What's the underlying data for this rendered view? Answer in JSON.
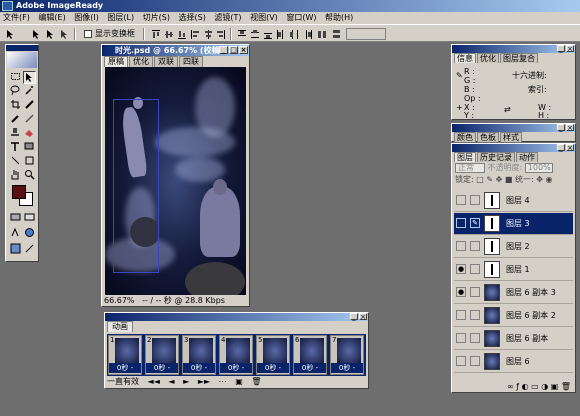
{
  "app": {
    "title": "Adobe ImageReady"
  },
  "menu": [
    "文件(F)",
    "编辑(E)",
    "图像(I)",
    "图层(L)",
    "切片(S)",
    "选择(S)",
    "滤镜(T)",
    "视图(V)",
    "窗口(W)",
    "帮助(H)"
  ],
  "options": {
    "show_bounds_label": "显示变换框"
  },
  "document": {
    "title": "时光.psd @ 66.67% (校稿)",
    "tabs": [
      "原稿",
      "优化",
      "双联",
      "四联"
    ],
    "active_tab": "原稿",
    "zoom": "66.67%",
    "status_time": "-- / -- 秒 @ 28.8 Kbps"
  },
  "animation": {
    "tab": "动画",
    "frames": [
      {
        "num": "1",
        "delay": "0秒 -"
      },
      {
        "num": "2",
        "delay": "0秒 -"
      },
      {
        "num": "3",
        "delay": "0秒 -"
      },
      {
        "num": "4",
        "delay": "0秒 -"
      },
      {
        "num": "5",
        "delay": "0秒 -"
      },
      {
        "num": "6",
        "delay": "0秒 -"
      },
      {
        "num": "7",
        "delay": "0秒 -"
      }
    ],
    "loop": "一直有效"
  },
  "info_panel": {
    "tabs": [
      "信息",
      "优化",
      "图层复合"
    ],
    "active_tab": "信息",
    "rows": {
      "r": "R :",
      "g": "G :",
      "b": "B :",
      "op": "Op :",
      "x": "X :",
      "y": "Y :",
      "w": "W :",
      "h": "H :"
    },
    "hex_label": "十六进制:",
    "index_label": "索引:"
  },
  "color_panel": {
    "tabs": [
      "颜色",
      "色板",
      "样式"
    ]
  },
  "layers_panel": {
    "tabs": [
      "图层",
      "历史记录",
      "动作"
    ],
    "active_tab": "图层",
    "blend_mode": "正常",
    "opacity_label": "不透明度:",
    "opacity_value": "100%",
    "lock_label": "锁定:",
    "unify_label": "统一:",
    "layers": [
      {
        "name": "图层 4",
        "eye": false,
        "thumb": "txt",
        "active": false
      },
      {
        "name": "图层 3",
        "eye": false,
        "thumb": "txt",
        "active": true
      },
      {
        "name": "图层 2",
        "eye": false,
        "thumb": "txt",
        "active": false
      },
      {
        "name": "图层 1",
        "eye": true,
        "thumb": "txt",
        "active": false
      },
      {
        "name": "图层 6 副本 3",
        "eye": true,
        "thumb": "img",
        "active": false
      },
      {
        "name": "图层 6 副本 2",
        "eye": false,
        "thumb": "img",
        "active": false
      },
      {
        "name": "图层 6 副本",
        "eye": false,
        "thumb": "img",
        "active": false
      },
      {
        "name": "图层 6",
        "eye": false,
        "thumb": "img",
        "active": false
      }
    ]
  }
}
